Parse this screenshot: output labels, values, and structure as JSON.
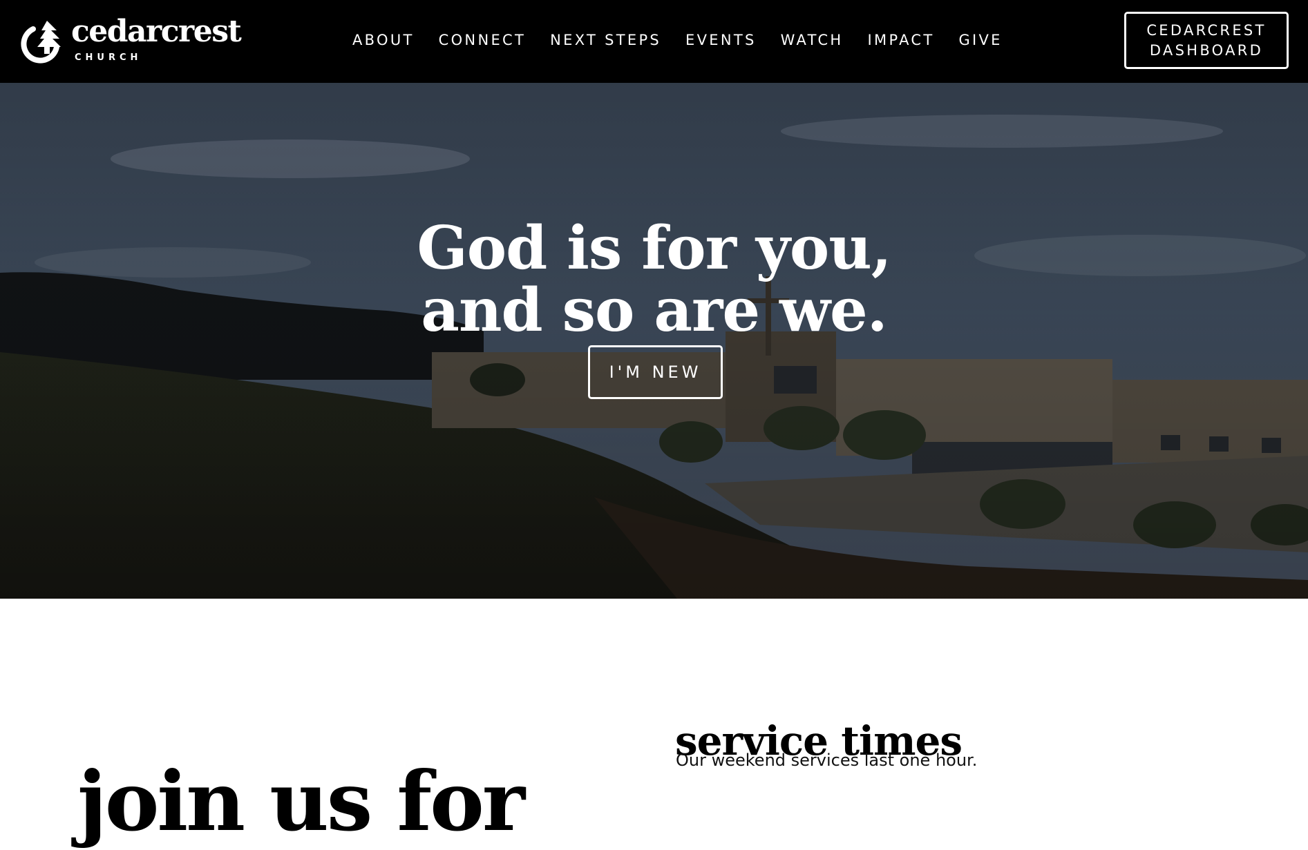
{
  "header": {
    "logo": {
      "name": "cedarcrest",
      "subtitle": "CHURCH"
    },
    "nav": [
      {
        "label": "ABOUT"
      },
      {
        "label": "CONNECT"
      },
      {
        "label": "NEXT STEPS"
      },
      {
        "label": "EVENTS"
      },
      {
        "label": "WATCH"
      },
      {
        "label": "IMPACT"
      },
      {
        "label": "GIVE"
      }
    ],
    "dashboard_button": {
      "line1": "CEDARCREST",
      "line2": "DASHBOARD"
    }
  },
  "hero": {
    "title_line1": "God is for you,",
    "title_line2": "and so are we.",
    "cta_label": "I'M NEW"
  },
  "join": {
    "heading": "join us for"
  },
  "service_times": {
    "heading": "service times",
    "description": "Our weekend services last one hour."
  },
  "colors": {
    "header_bg": "#000000",
    "text_light": "#ffffff",
    "text_dark": "#000000"
  },
  "icons": {
    "logo_mark": "cedar-tree-logo-icon"
  }
}
